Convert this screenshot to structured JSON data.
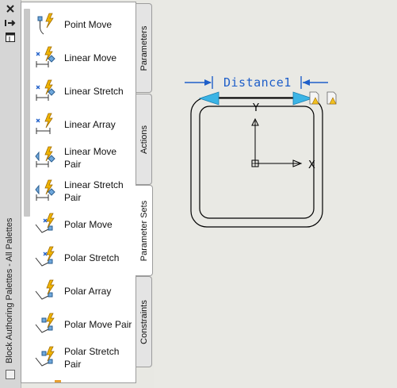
{
  "palette": {
    "title": "Block Authoring Palettes - All Palettes",
    "items": [
      {
        "label": "Point Move",
        "icon": "point-move-icon"
      },
      {
        "label": "Linear Move",
        "icon": "linear-move-icon"
      },
      {
        "label": "Linear Stretch",
        "icon": "linear-stretch-icon"
      },
      {
        "label": "Linear Array",
        "icon": "linear-array-icon"
      },
      {
        "label": "Linear Move Pair",
        "icon": "linear-move-pair-icon"
      },
      {
        "label": "Linear Stretch Pair",
        "icon": "linear-stretch-pair-icon"
      },
      {
        "label": "Polar Move",
        "icon": "polar-move-icon"
      },
      {
        "label": "Polar Stretch",
        "icon": "polar-stretch-icon"
      },
      {
        "label": "Polar Array",
        "icon": "polar-array-icon"
      },
      {
        "label": "Polar Move Pair",
        "icon": "polar-move-pair-icon"
      },
      {
        "label": "Polar Stretch Pair",
        "icon": "polar-stretch-pair-icon"
      }
    ],
    "tabs": [
      {
        "label": "Parameters",
        "active": false
      },
      {
        "label": "Actions",
        "active": false
      },
      {
        "label": "Parameter Sets",
        "active": true
      },
      {
        "label": "Constraints",
        "active": false
      }
    ]
  },
  "canvas": {
    "parameter_label": "Distance1",
    "x_axis_label": "X",
    "y_axis_label": "Y",
    "colors": {
      "dimension": "#1f5fc9",
      "grip": "#3bb4e5",
      "geometry": "#000000"
    }
  }
}
